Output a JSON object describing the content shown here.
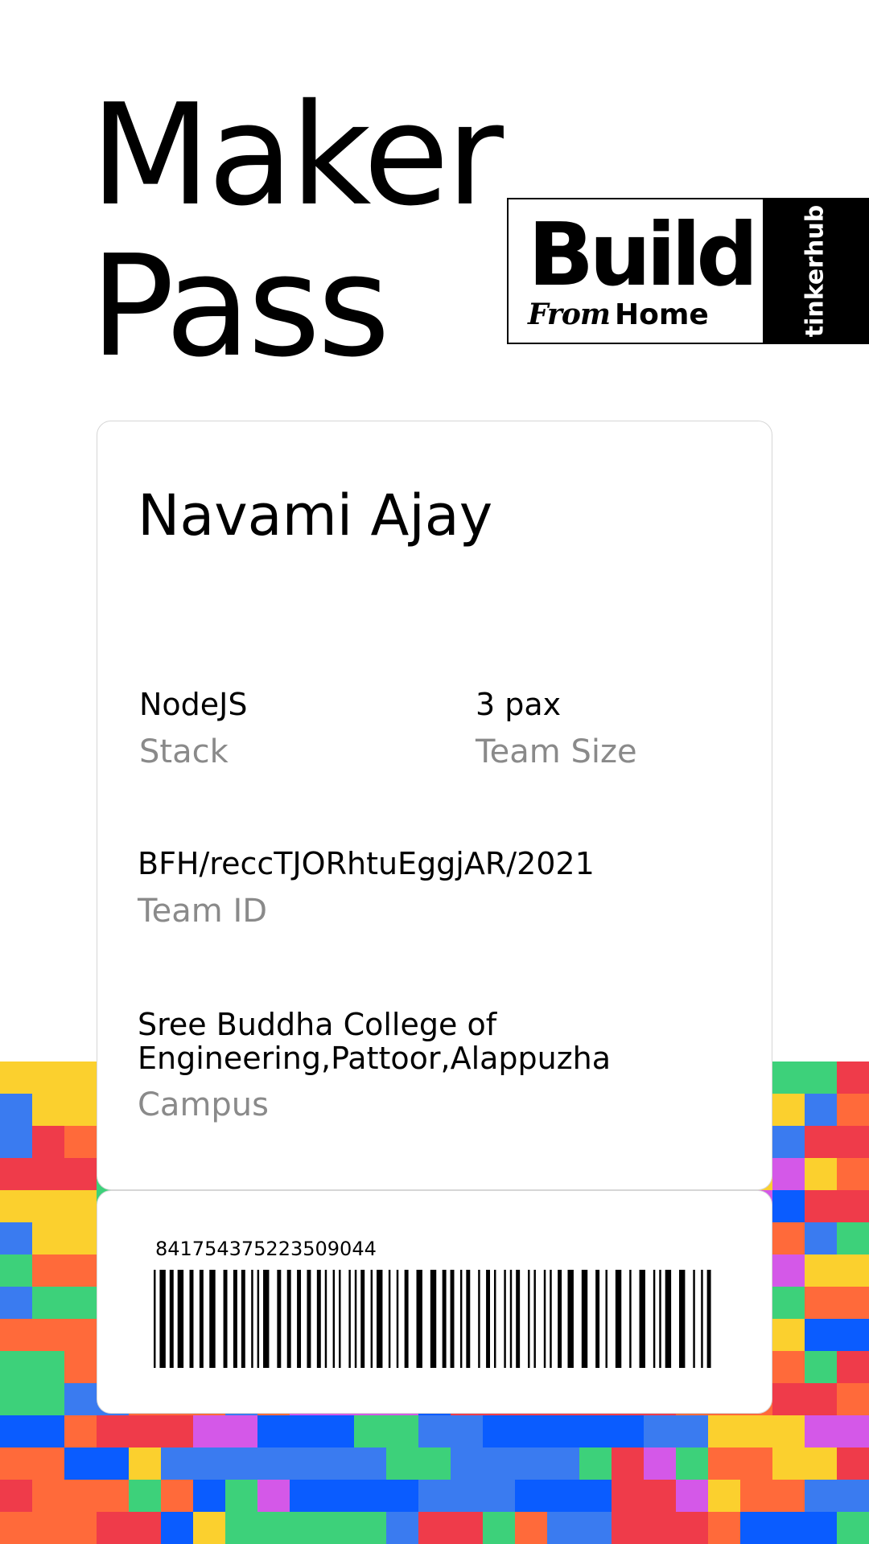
{
  "pass": {
    "title_line1": "Maker",
    "title_line2": "Pass",
    "logo": {
      "build": "Build",
      "from": "From",
      "home": "Home",
      "brand": "tinkerhub",
      "colors": {
        "fg": "#000000",
        "bg": "#ffffff"
      }
    },
    "name": "Navami Ajay",
    "stack": {
      "value": "NodeJS",
      "label": "Stack"
    },
    "team_size": {
      "value": "3 pax",
      "label": "Team Size"
    },
    "team_id": {
      "value": "BFH/reccTJORhtuEggjAR/2021",
      "label": "Team ID"
    },
    "campus": {
      "value_line1": "Sree Buddha College of",
      "value_line2": "Engineering,Pattoor,Alappuzha",
      "label": "Campus"
    },
    "barcode_number": "841754375223509044"
  },
  "colors": {
    "label_gray": "#8a8a8a",
    "card_border": "#d6d6d6",
    "mosaic_palette": [
      "#ef3b4a",
      "#3a7bf0",
      "#3dd17a",
      "#fbd02e",
      "#ff6a3a",
      "#d458e8",
      "#0a5cff"
    ]
  }
}
